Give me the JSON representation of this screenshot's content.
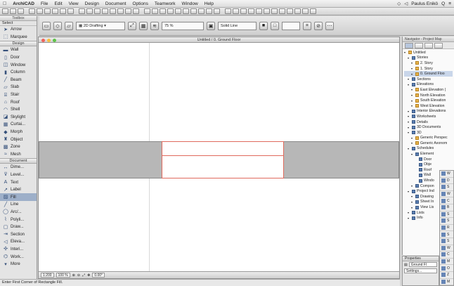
{
  "menubar": {
    "app": "ArchiCAD",
    "items": [
      "File",
      "Edit",
      "View",
      "Design",
      "Document",
      "Options",
      "Teamwork",
      "Window",
      "Help"
    ],
    "user": "Paulus Enikö"
  },
  "infobox": {
    "title": "Toolbox",
    "pen_label": "2D Drafting",
    "zoom": "75 %",
    "fill_type": "Solid Line"
  },
  "toolbox": {
    "header": "Toolbox",
    "subheader": "Select",
    "groups": [
      {
        "label": "Select",
        "tools": [
          {
            "label": "Arrow",
            "icon": "arrow-icon"
          },
          {
            "label": "Marquee",
            "icon": "marquee-icon"
          }
        ]
      },
      {
        "label": "Design",
        "tools": [
          {
            "label": "Wall",
            "icon": "wall-icon"
          },
          {
            "label": "Door",
            "icon": "door-icon"
          },
          {
            "label": "Window",
            "icon": "window-icon"
          },
          {
            "label": "Column",
            "icon": "column-icon"
          },
          {
            "label": "Beam",
            "icon": "beam-icon"
          },
          {
            "label": "Slab",
            "icon": "slab-icon"
          },
          {
            "label": "Stair",
            "icon": "stair-icon"
          },
          {
            "label": "Roof",
            "icon": "roof-icon"
          },
          {
            "label": "Shell",
            "icon": "shell-icon"
          },
          {
            "label": "Skylight",
            "icon": "skylight-icon"
          },
          {
            "label": "Curtai...",
            "icon": "curtain-wall-icon"
          },
          {
            "label": "Morph",
            "icon": "morph-icon"
          },
          {
            "label": "Object",
            "icon": "object-icon"
          },
          {
            "label": "Zone",
            "icon": "zone-icon"
          },
          {
            "label": "Mesh",
            "icon": "mesh-icon"
          }
        ]
      },
      {
        "label": "Document",
        "tools": [
          {
            "label": "Dime...",
            "icon": "dimension-icon"
          },
          {
            "label": "Level...",
            "icon": "level-icon"
          },
          {
            "label": "Text",
            "icon": "text-icon"
          },
          {
            "label": "Label",
            "icon": "label-icon"
          },
          {
            "label": "Fill",
            "icon": "fill-icon"
          },
          {
            "label": "Line",
            "icon": "line-icon"
          },
          {
            "label": "Arc/...",
            "icon": "arc-icon"
          },
          {
            "label": "Polyli...",
            "icon": "polyline-icon"
          },
          {
            "label": "Draw...",
            "icon": "drawing-icon"
          },
          {
            "label": "Section",
            "icon": "section-icon"
          },
          {
            "label": "Eleva...",
            "icon": "elevation-icon"
          },
          {
            "label": "Interi...",
            "icon": "interior-icon"
          },
          {
            "label": "Work...",
            "icon": "worksheet-icon"
          },
          {
            "label": "More",
            "icon": "more-icon"
          }
        ]
      }
    ],
    "selected_tool": "Fill"
  },
  "window": {
    "title": "Untitled / 0. Ground Floor",
    "zoom_status": "1:200",
    "scale_status": "100 %",
    "angle_status": "0.00°"
  },
  "prompt": "Enter First Corner of Rectangle Fill.",
  "navigator": {
    "title": "Navigator - Project Map",
    "tree": [
      {
        "label": "Untitled",
        "indent": 0,
        "icon": "y"
      },
      {
        "label": "Stories",
        "indent": 1,
        "icon": "b"
      },
      {
        "label": "2. Story",
        "indent": 2,
        "icon": "y"
      },
      {
        "label": "1. Story",
        "indent": 2,
        "icon": "y"
      },
      {
        "label": "0. Ground Floo",
        "indent": 2,
        "icon": "y",
        "selected": true
      },
      {
        "label": "Sections",
        "indent": 1,
        "icon": "b"
      },
      {
        "label": "Elevations",
        "indent": 1,
        "icon": "b"
      },
      {
        "label": "East Elevation (",
        "indent": 2,
        "icon": "y"
      },
      {
        "label": "North Elevation",
        "indent": 2,
        "icon": "y"
      },
      {
        "label": "South Elevation",
        "indent": 2,
        "icon": "y"
      },
      {
        "label": "West Elevation",
        "indent": 2,
        "icon": "y"
      },
      {
        "label": "Interior Elevations",
        "indent": 1,
        "icon": "b"
      },
      {
        "label": "Worksheets",
        "indent": 1,
        "icon": "b"
      },
      {
        "label": "Details",
        "indent": 1,
        "icon": "b"
      },
      {
        "label": "3D Documents",
        "indent": 1,
        "icon": "b"
      },
      {
        "label": "3D",
        "indent": 1,
        "icon": "b"
      },
      {
        "label": "Generic Perspec",
        "indent": 2,
        "icon": "y"
      },
      {
        "label": "Generic Axonom",
        "indent": 2,
        "icon": "y"
      },
      {
        "label": "Schedules",
        "indent": 1,
        "icon": "b"
      },
      {
        "label": "Element",
        "indent": 2,
        "icon": "b"
      },
      {
        "label": "Door",
        "indent": 3,
        "icon": "b"
      },
      {
        "label": "Obje",
        "indent": 3,
        "icon": "b"
      },
      {
        "label": "Roof",
        "indent": 3,
        "icon": "b"
      },
      {
        "label": "Wall",
        "indent": 3,
        "icon": "b"
      },
      {
        "label": "Windo",
        "indent": 3,
        "icon": "b"
      },
      {
        "label": "Compon",
        "indent": 2,
        "icon": "b"
      },
      {
        "label": "Project Ind",
        "indent": 1,
        "icon": "b"
      },
      {
        "label": "Drawing",
        "indent": 2,
        "icon": "b"
      },
      {
        "label": "Sheet In",
        "indent": 2,
        "icon": "b"
      },
      {
        "label": "View Lis",
        "indent": 2,
        "icon": "b"
      },
      {
        "label": "Lists",
        "indent": 1,
        "icon": "b"
      },
      {
        "label": "Info",
        "indent": 1,
        "icon": "b"
      }
    ]
  },
  "mini_palette": [
    "W",
    "D",
    "S",
    "W",
    "C",
    "B",
    "S",
    "S",
    "R",
    "S",
    "S",
    "W",
    "C",
    "M",
    "O",
    "Z",
    "M"
  ],
  "properties": {
    "title": "Properties",
    "story": "Ground Fl",
    "settings": "Settings..."
  }
}
